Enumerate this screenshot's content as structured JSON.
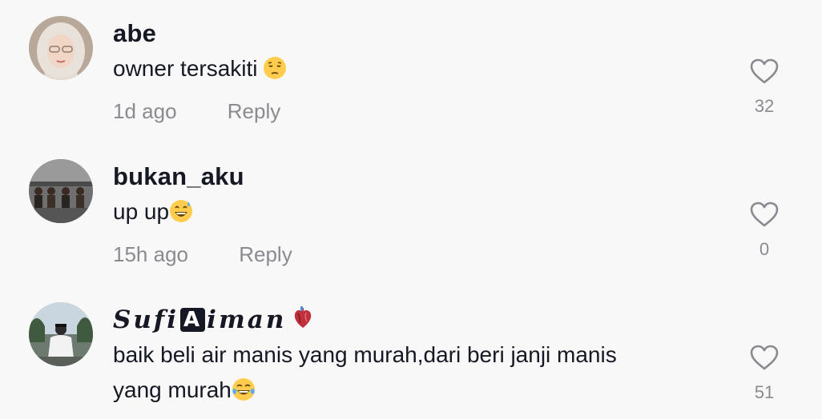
{
  "comments": [
    {
      "username": "abe",
      "text": "owner tersakiti",
      "emoji": "pensive-face-emoji",
      "time": "1d ago",
      "reply_label": "Reply",
      "like_count": "32"
    },
    {
      "username": "bukan_aku",
      "text": "up up",
      "emoji": "grinning-face-with-sweat-emoji",
      "time": "15h ago",
      "reply_label": "Reply",
      "like_count": "0"
    },
    {
      "username_parts": [
        "Sufi",
        "A",
        "iman"
      ],
      "username_emoji": "anatomical-heart-emoji",
      "text_line1": "baik beli air manis yang murah,dari beri janji manis",
      "text_line2": "yang murah",
      "emoji": "face-with-tears-of-joy-emoji",
      "like_count": "51"
    }
  ],
  "colors": {
    "background": "#f8f8f8",
    "primary_text": "#161823",
    "secondary_text": "#8a8b91"
  },
  "icons": {
    "like": "heart-outline-icon"
  }
}
